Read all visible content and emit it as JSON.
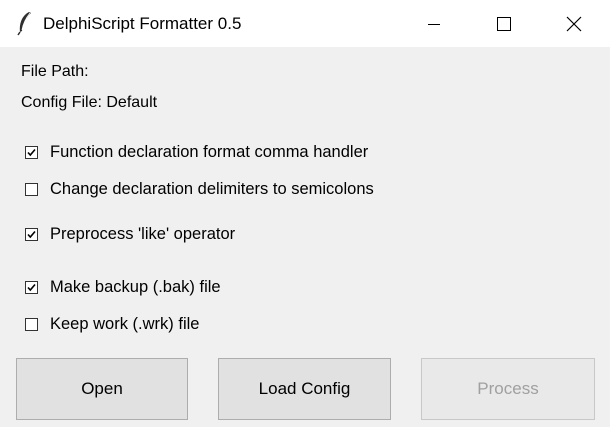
{
  "window": {
    "title": "DelphiScript Formatter 0.5",
    "icon": "feather-icon",
    "controls": [
      "minimize-icon",
      "maximize-icon",
      "close-icon"
    ]
  },
  "info": {
    "file_path_label": "File Path:",
    "config_file_label": "Config File: Default"
  },
  "options": [
    {
      "label": "Function declaration format comma handler",
      "checked": true
    },
    {
      "label": "Change declaration delimiters to semicolons",
      "checked": false
    },
    {
      "label": "Preprocess 'like' operator",
      "checked": true
    },
    {
      "label": "Make backup (.bak) file",
      "checked": true
    },
    {
      "label": "Keep work (.wrk) file",
      "checked": false
    }
  ],
  "buttons": {
    "open": "Open",
    "load_config": "Load Config",
    "process": "Process",
    "process_disabled": true
  }
}
